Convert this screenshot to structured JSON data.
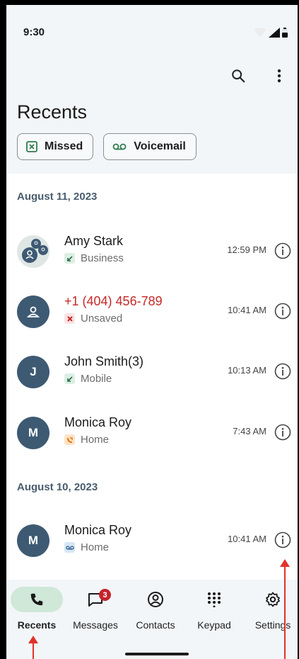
{
  "status": {
    "time": "9:30"
  },
  "appbar": {
    "title": "Recents",
    "search_icon": "search-icon",
    "more_icon": "more-vert-icon"
  },
  "filters": [
    {
      "label": "Missed",
      "icon": "missed-call-box-icon"
    },
    {
      "label": "Voicemail",
      "icon": "voicemail-icon"
    }
  ],
  "sections": [
    {
      "date": "August 11, 2023",
      "calls": [
        {
          "name": "Amy Stark",
          "type": "Business",
          "time": "12:59 PM",
          "call_icon": "incoming-call-icon",
          "avatar": "group-avatar"
        },
        {
          "name": "+1 (404) 456-789",
          "type": "Unsaved",
          "time": "10:41 AM",
          "call_icon": "missed-call-icon",
          "avatar": "person-icon"
        },
        {
          "name": "John Smith(3)",
          "type": "Mobile",
          "time": "10:13 AM",
          "call_icon": "incoming-call-icon",
          "avatar_letter": "J"
        },
        {
          "name": "Monica Roy",
          "type": "Home",
          "time": "7:43 AM",
          "call_icon": "outgoing-call-icon",
          "avatar_letter": "M"
        }
      ]
    },
    {
      "date": "August 10, 2023",
      "calls": [
        {
          "name": "Monica Roy",
          "type": "Home",
          "time": "10:41 AM",
          "call_icon": "voicemail-icon",
          "avatar_letter": "M"
        }
      ]
    }
  ],
  "nav": [
    {
      "label": "Recents",
      "icon": "phone-icon",
      "active": true
    },
    {
      "label": "Messages",
      "icon": "message-icon",
      "badge": "3"
    },
    {
      "label": "Contacts",
      "icon": "contacts-icon"
    },
    {
      "label": "Keypad",
      "icon": "dialpad-icon"
    },
    {
      "label": "Settings",
      "icon": "settings-icon"
    }
  ],
  "colors": {
    "accent_green": "#cfe8d8",
    "avatar_blue": "#3e5a73",
    "missed_red": "#c62828",
    "annotation_red": "#e0332b"
  }
}
